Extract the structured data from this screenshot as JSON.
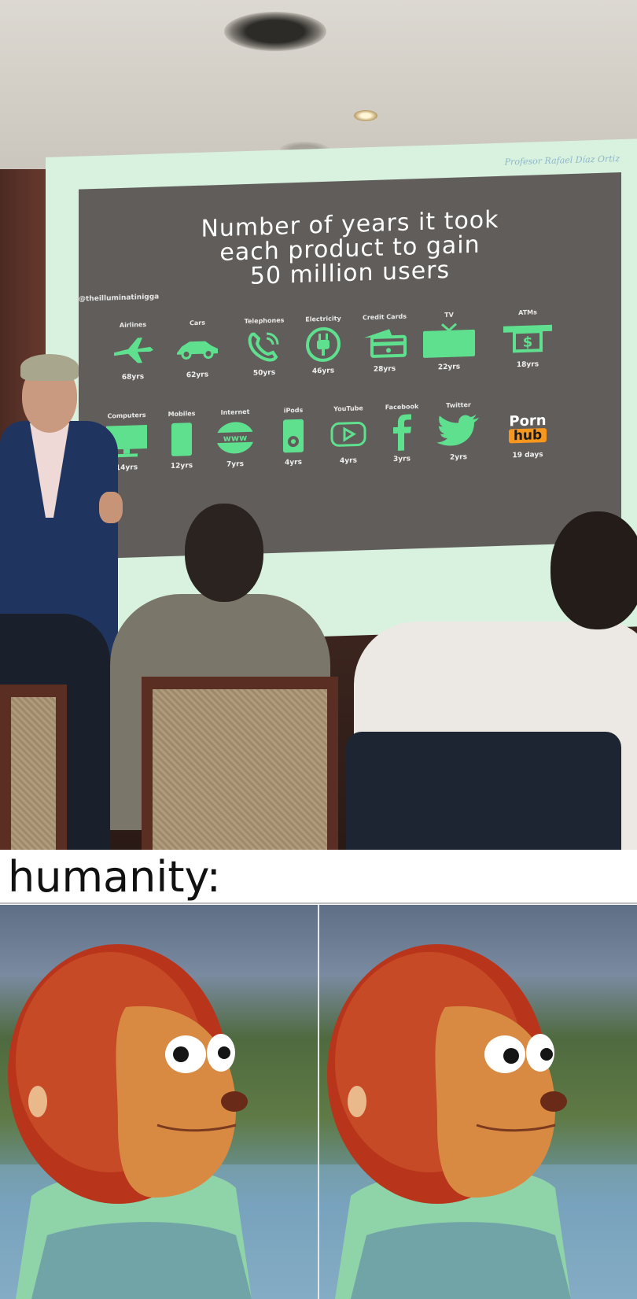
{
  "photo": {
    "credit": "Profesor Rafael Díaz Ortiz",
    "slide": {
      "title_lines": [
        "Number of years it took",
        "each product to gain",
        "50 million users"
      ],
      "handle": "@theilluminatinigga",
      "row1": [
        {
          "label": "Airlines",
          "years": "68yrs",
          "icon": "airplane-icon"
        },
        {
          "label": "Cars",
          "years": "62yrs",
          "icon": "car-icon"
        },
        {
          "label": "Telephones",
          "years": "50yrs",
          "icon": "telephone-icon"
        },
        {
          "label": "Electricity",
          "years": "46yrs",
          "icon": "plug-icon"
        },
        {
          "label": "Credit Cards",
          "years": "28yrs",
          "icon": "credit-card-icon"
        },
        {
          "label": "TV",
          "years": "22yrs",
          "icon": "tv-icon"
        },
        {
          "label": "ATMs",
          "years": "18yrs",
          "icon": "atm-icon"
        }
      ],
      "row2": [
        {
          "label": "Computers",
          "years": "14yrs",
          "icon": "monitor-icon"
        },
        {
          "label": "Mobiles",
          "years": "12yrs",
          "icon": "mobile-icon"
        },
        {
          "label": "Internet",
          "years": "7yrs",
          "icon": "globe-icon"
        },
        {
          "label": "iPods",
          "years": "4yrs",
          "icon": "ipod-icon"
        },
        {
          "label": "YouTube",
          "years": "4yrs",
          "icon": "play-icon"
        },
        {
          "label": "Facebook",
          "years": "3yrs",
          "icon": "facebook-icon"
        },
        {
          "label": "Twitter",
          "years": "2yrs",
          "icon": "bird-icon"
        },
        {
          "label": "",
          "years": "19 days",
          "icon": "pornhub-logo",
          "logo_top": "Porn",
          "logo_bottom": "hub"
        }
      ]
    }
  },
  "caption": "humanity:",
  "colors": {
    "icon_green": "#5fe08f",
    "slide_bg": "#615d5a",
    "screen_glow": "#d8f2df",
    "hub_orange": "#f7971d"
  }
}
